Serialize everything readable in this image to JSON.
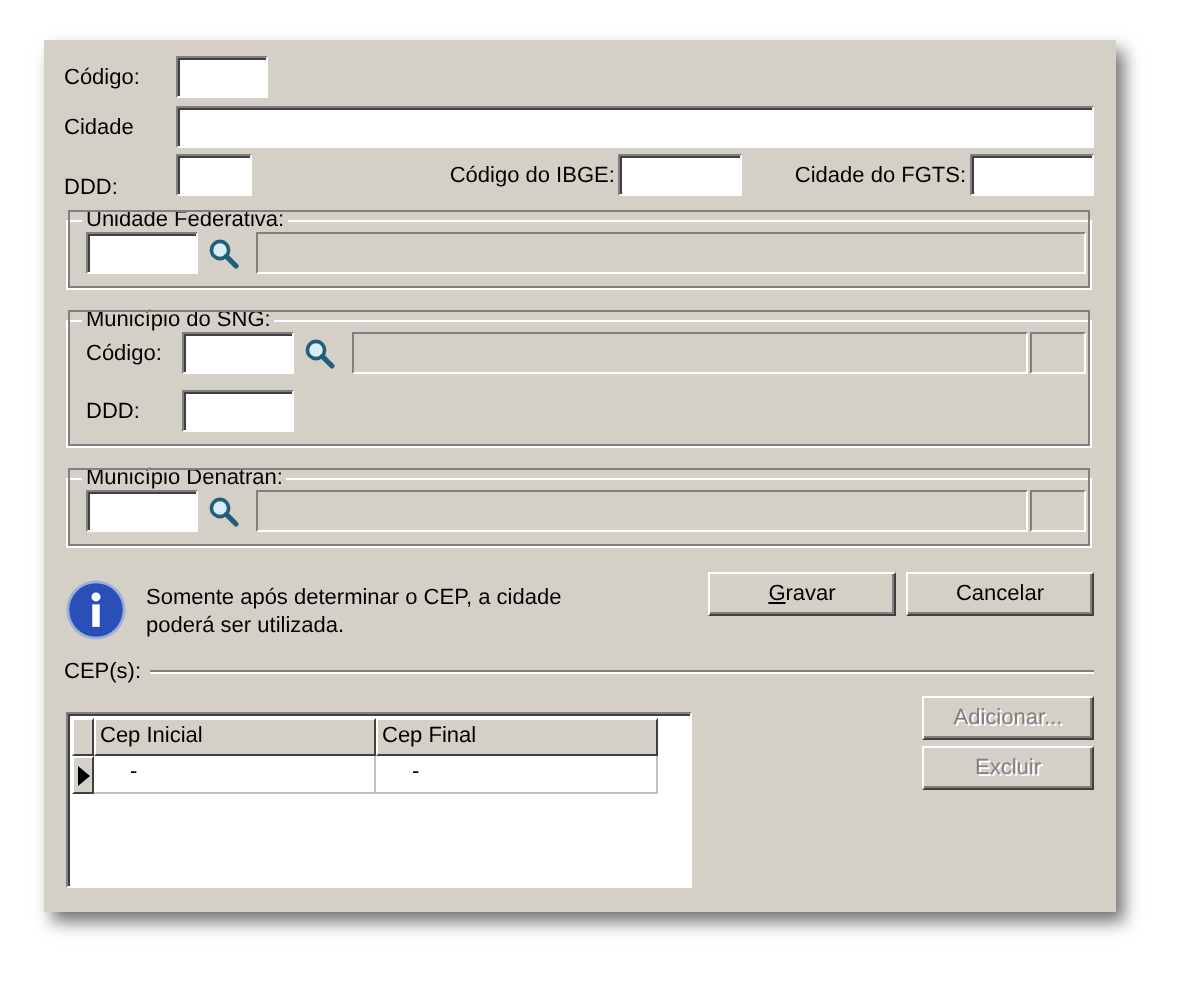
{
  "top_fields": {
    "codigo": {
      "label": "Código:"
    },
    "cidade": {
      "label": "Cidade"
    },
    "ddd": {
      "label": "DDD:"
    },
    "ibge": {
      "label": "Código do IBGE:"
    },
    "fgts": {
      "label": "Cidade do FGTS:"
    }
  },
  "uf": {
    "title": "Unidade Federativa:"
  },
  "sng": {
    "title": "Município do SNG:",
    "code_label": "Código:",
    "ddd_label": "DDD:"
  },
  "denatran": {
    "title": "Município Denatran:"
  },
  "info": {
    "message": "Somente após determinar o CEP, a cidade poderá ser utilizada."
  },
  "buttons": [
    {
      "label": "Gravar",
      "access_key": true
    },
    {
      "label": "Cancelar",
      "access_key": false
    }
  ],
  "cep": {
    "title": "CEP(s):",
    "columns": [
      "Cep Inicial",
      "Cep Final"
    ],
    "rows": [
      {
        "current": true,
        "cells": [
          "-",
          "-"
        ]
      }
    ],
    "buttons": [
      {
        "label": "Adicionar...",
        "disabled": true
      },
      {
        "label": "Excluir",
        "disabled": true
      }
    ]
  }
}
